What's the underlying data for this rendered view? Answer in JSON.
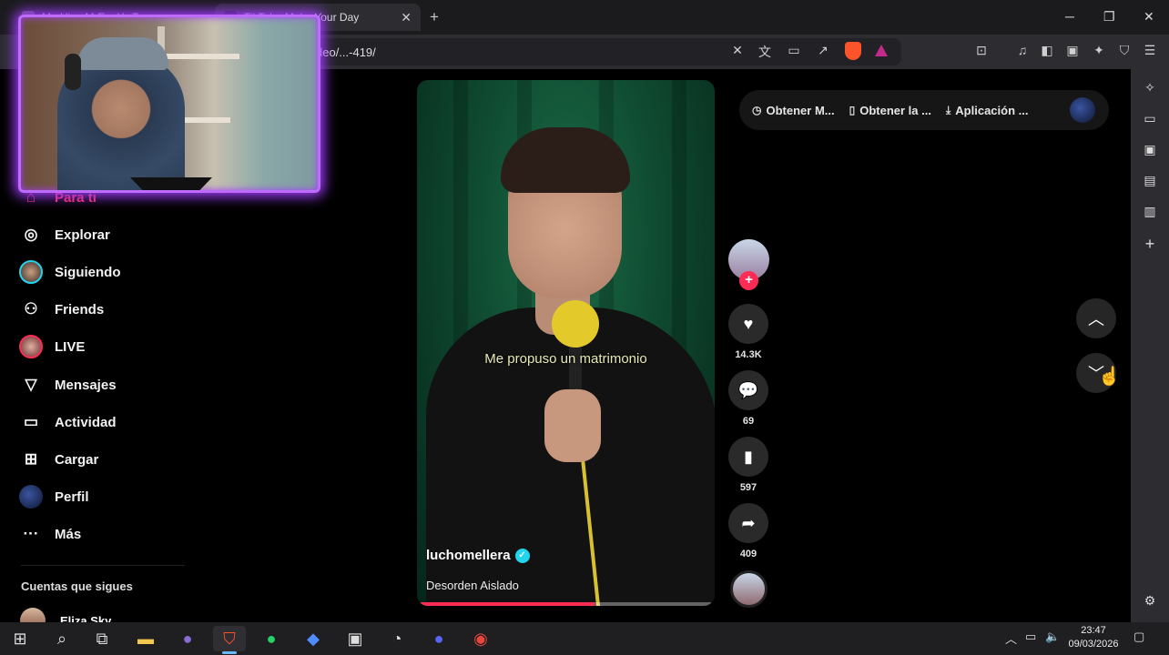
{
  "browser": {
    "tabs": [
      {
        "title": "Me Hizo M-E... Yo Te...",
        "active": false
      },
      {
        "title": "TikTok - Make Your Day",
        "active": true
      }
    ],
    "new_tab_label": "+",
    "window_controls": {
      "minimize": "─",
      "maximize": "❐",
      "close": "✕"
    },
    "address_text": "/video/...-419/",
    "toolbar_icons": [
      "translate-off-icon",
      "translate-icon",
      "cast-icon",
      "share-icon",
      "brave-shield-icon",
      "brave-rewards-icon",
      "tab-search-icon",
      "music-icon",
      "sidebar-icon",
      "wallet-icon",
      "leo-icon",
      "vpn-icon",
      "menu-icon"
    ]
  },
  "nav": {
    "items": [
      {
        "label": "Para ti",
        "icon": "home-icon",
        "active": true
      },
      {
        "label": "Explorar",
        "icon": "compass-icon"
      },
      {
        "label": "Siguiendo",
        "icon": "following-avatar"
      },
      {
        "label": "Friends",
        "icon": "friends-icon"
      },
      {
        "label": "LIVE",
        "icon": "live-avatar"
      },
      {
        "label": "Mensajes",
        "icon": "send-icon"
      },
      {
        "label": "Actividad",
        "icon": "activity-icon"
      },
      {
        "label": "Cargar",
        "icon": "upload-icon"
      },
      {
        "label": "Perfil",
        "icon": "profile-avatar"
      },
      {
        "label": "Más",
        "icon": "more-icon"
      }
    ],
    "following_header": "Cuentas que sigues",
    "following_users": [
      "Eliza Sky"
    ]
  },
  "promo": {
    "items": [
      "Obtener M...",
      "Obtener la ...",
      "Aplicación ..."
    ]
  },
  "video": {
    "caption": "Me propuso un matrimonio",
    "username": "luchomellera",
    "verified": true,
    "description": "Desorden Aislado",
    "progress": 0.6
  },
  "actions": {
    "likes": "14.3K",
    "comments": "69",
    "saves": "597",
    "shares": "409"
  },
  "taskbar": {
    "clock_time": "23:47",
    "clock_date": "09/03/2026",
    "apps": [
      "start-icon",
      "search-icon",
      "task-view-icon",
      "file-explorer-icon",
      "discord-icon",
      "brave-icon",
      "whatsapp-icon",
      "app-icon",
      "capture-icon",
      "speedtest-icon",
      "discord-badge-icon",
      "chrome-icon"
    ]
  },
  "colors": {
    "accent": "#fe2c55",
    "verified": "#20d5ec",
    "webcam_glow": "#a13dff"
  }
}
